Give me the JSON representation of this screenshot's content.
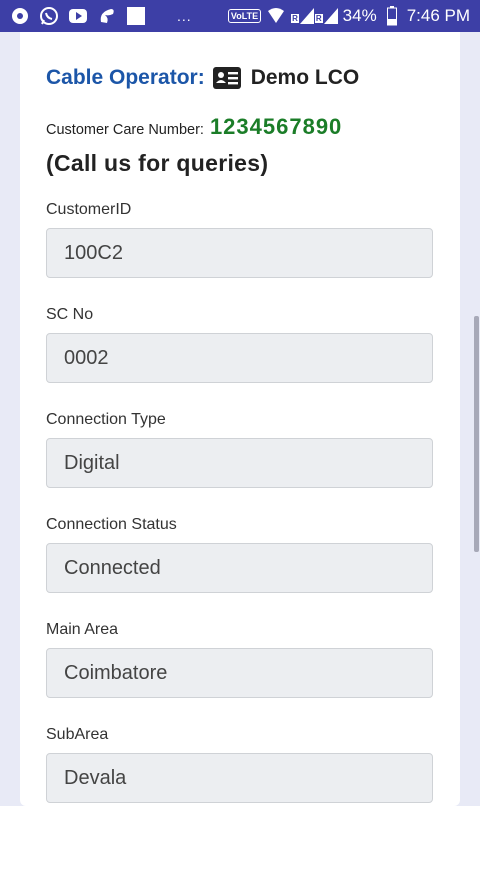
{
  "status_bar": {
    "battery": "34%",
    "time": "7:46 PM",
    "volte": "VoLTE",
    "sim_badge": "R",
    "dots": "...",
    "icons": [
      "app-icon",
      "whatsapp-icon",
      "youtube-icon",
      "app-icon-2",
      "notification-icon",
      "wifi-icon",
      "signal-icon",
      "battery-icon"
    ]
  },
  "header": {
    "operator_label": "Cable Operator:",
    "operator_icon": "id-card-icon",
    "operator_name": "Demo LCO",
    "care_label": "Customer Care Number:",
    "care_number": "1234567890",
    "call_us": "(Call us for queries)"
  },
  "fields": [
    {
      "label": "CustomerID",
      "value": "100C2"
    },
    {
      "label": "SC No",
      "value": "0002"
    },
    {
      "label": "Connection Type",
      "value": "Digital"
    },
    {
      "label": "Connection Status",
      "value": "Connected"
    },
    {
      "label": "Main Area",
      "value": "Coimbatore"
    },
    {
      "label": "SubArea",
      "value": "Devala"
    }
  ],
  "colors": {
    "status_bar": "#3d3fa6",
    "operator_label": "#1c56a8",
    "care_number": "#1b7d28",
    "page_background": "#e8eaf6",
    "field_background": "#eceef1"
  }
}
